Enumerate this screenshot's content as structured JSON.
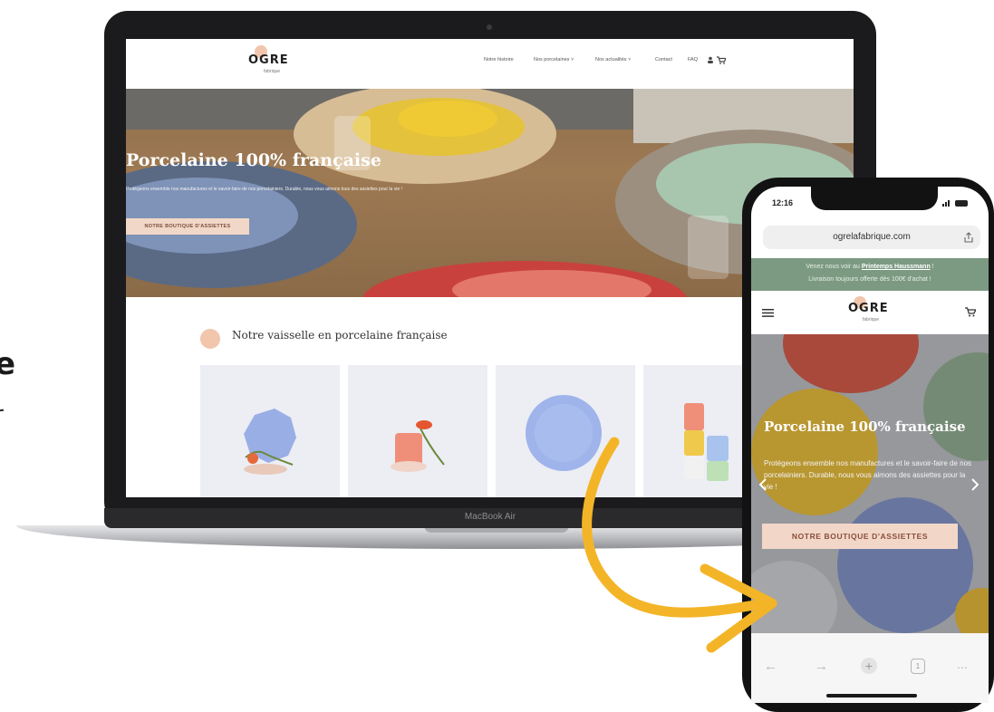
{
  "side_text": {
    "line1": "e",
    "line2": "r"
  },
  "laptop": {
    "model_label": "MacBook Air"
  },
  "desktop_site": {
    "logo_text": "OGRE",
    "logo_subtext": "fabrique",
    "nav": {
      "item1": "Notre histoire",
      "item2": "Nos porcelaines ˅",
      "item3": "Nos actualités ˅",
      "item4": "Contact",
      "item5": "FAQ"
    },
    "hero": {
      "title": "Porcelaine 100% française",
      "subtitle": "Protégeons ensemble nos manufactures et le savoir-faire de nos porcelainiers. Durable, nous vous aimons tous des assiettes pour la vie !",
      "button": "NOTRE BOUTIQUE D'ASSIETTES"
    },
    "section_title": "Notre vaisselle en porcelaine française"
  },
  "phone": {
    "time": "12:16",
    "url": "ogrelafabrique.com",
    "banner": {
      "line1_prefix": "Venez nous voir au ",
      "line1_link": "Printemps Haussmann",
      "line1_suffix": " !",
      "line2": "Livraison toujours offerte dès 100€ d'achat !"
    },
    "logo_text": "OGRE",
    "logo_subtext": "fabrique",
    "hero": {
      "title": "Porcelaine 100% française",
      "subtitle": "Protégeons ensemble nos manufactures et le savoir-faire de nos porcelainiers. Durable, nous vous aimons des assiettes pour la vie !",
      "button": "NOTRE BOUTIQUE D'ASSIETTES"
    },
    "toolbar": {
      "back": "←",
      "forward": "→",
      "new_tab": "+",
      "tabs": "1",
      "more": "⋯"
    }
  },
  "colors": {
    "accent_peach": "#f2c5ad",
    "button_bg": "#f1d7c7",
    "banner_green": "#7c9a81",
    "arrow_yellow": "#f3b527",
    "device_dark": "#1b1b1d"
  },
  "icons": [
    "search-icon",
    "account-icon",
    "cart-icon",
    "hamburger-menu-icon",
    "share-icon",
    "lock-icon",
    "back-arrow-icon",
    "forward-arrow-icon",
    "new-tab-icon",
    "tabs-icon",
    "more-icon",
    "chevron-left-icon",
    "chevron-right-icon",
    "curved-arrow-icon"
  ]
}
